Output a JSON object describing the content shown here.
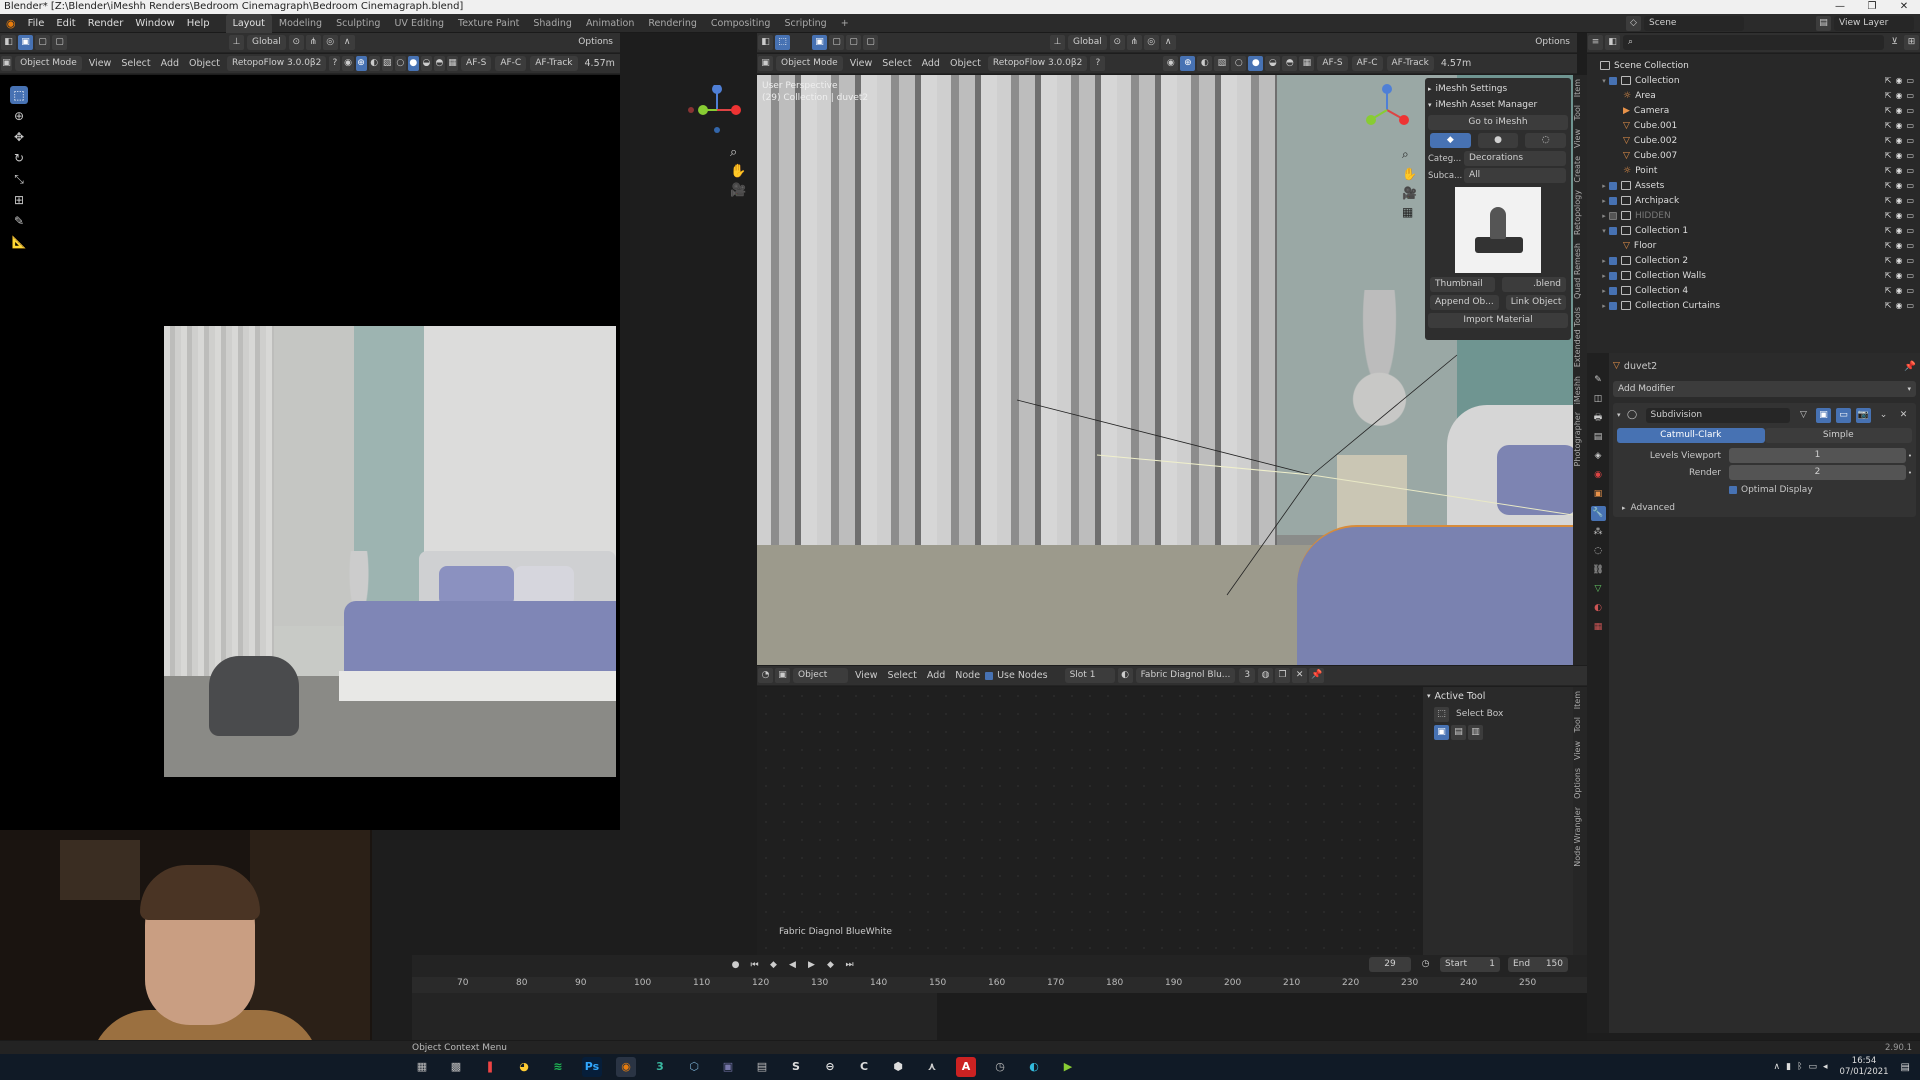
{
  "window": {
    "title": "Blender* [Z:\\Blender\\iMeshh Renders\\Bedroom Cinemagraph\\Bedroom Cinemagraph.blend]",
    "min": "—",
    "max": "❐",
    "close": "✕"
  },
  "menu": [
    "File",
    "Edit",
    "Render",
    "Window",
    "Help"
  ],
  "workspaces": [
    {
      "label": "Layout",
      "active": true
    },
    {
      "label": "Modeling"
    },
    {
      "label": "Sculpting"
    },
    {
      "label": "UV Editing"
    },
    {
      "label": "Texture Paint"
    },
    {
      "label": "Shading"
    },
    {
      "label": "Animation"
    },
    {
      "label": "Rendering"
    },
    {
      "label": "Compositing"
    },
    {
      "label": "Scripting"
    },
    {
      "label": "+"
    }
  ],
  "scene": {
    "label": "Scene",
    "view_layer": "View Layer"
  },
  "left_viewport": {
    "mode": "Object Mode",
    "menus": [
      "View",
      "Select",
      "Add",
      "Object"
    ],
    "addon": "RetopoFlow 3.0.0β2",
    "transform": "Global",
    "options": "Options",
    "af_s": "AF-S",
    "af_c": "AF-C",
    "af_track": "AF-Track",
    "dist": "4.57m"
  },
  "main_viewport": {
    "mode": "Object Mode",
    "menus": [
      "View",
      "Select",
      "Add",
      "Object"
    ],
    "addon": "RetopoFlow 3.0.0β2",
    "transform": "Global",
    "options": "Options",
    "af_s": "AF-S",
    "af_c": "AF-C",
    "af_track": "AF-Track",
    "dist": "4.57m",
    "overlay_title": "User Perspective",
    "overlay_sub": "(29) Collection | duvet2"
  },
  "imeshh": {
    "settings": "iMeshh Settings",
    "manager": "iMeshh Asset Manager",
    "goto": "Go to iMeshh",
    "category_label": "Categ...",
    "category": "Decorations",
    "subcat_label": "Subca...",
    "subcat": "All",
    "thumbnail": "Thumbnail",
    "blend": ".blend",
    "append": "Append Ob...",
    "link": "Link Object",
    "import": "Import Material"
  },
  "viewport_tabs": [
    "Item",
    "Tool",
    "View",
    "Create",
    "Retopology",
    "Quad Remesh",
    "Extended Tools",
    "iMeshh",
    "Photographer"
  ],
  "node_editor": {
    "type": "Object",
    "menus": [
      "View",
      "Select",
      "Add",
      "Node"
    ],
    "use_nodes": "Use Nodes",
    "slot": "Slot 1",
    "material": "Fabric Diagnol Blu...",
    "users": "3",
    "frame_label": "Fabric Diagnol BlueWhite",
    "active_tool": "Active Tool",
    "select_box": "Select Box",
    "tabs": [
      "Item",
      "Tool",
      "View",
      "Options",
      "Node Wrangler"
    ]
  },
  "outliner": {
    "title": "Scene Collection",
    "items": [
      {
        "label": "Collection",
        "depth": 0,
        "type": "coll",
        "open": true,
        "check": true
      },
      {
        "label": "Area",
        "depth": 1,
        "type": "obj",
        "icon": "☼"
      },
      {
        "label": "Camera",
        "depth": 1,
        "type": "obj",
        "icon": "▶"
      },
      {
        "label": "Cube.001",
        "depth": 1,
        "type": "obj",
        "icon": "▽"
      },
      {
        "label": "Cube.002",
        "depth": 1,
        "type": "obj",
        "icon": "▽"
      },
      {
        "label": "Cube.007",
        "depth": 1,
        "type": "obj",
        "icon": "▽"
      },
      {
        "label": "Point",
        "depth": 1,
        "type": "obj",
        "icon": "☼"
      },
      {
        "label": "Assets",
        "depth": 0,
        "type": "coll",
        "check": true
      },
      {
        "label": "Archipack",
        "depth": 0,
        "type": "coll",
        "check": true
      },
      {
        "label": "HIDDEN",
        "depth": 0,
        "type": "coll",
        "check": false,
        "dim": true
      },
      {
        "label": "Collection 1",
        "depth": 0,
        "type": "coll",
        "open": true,
        "check": true
      },
      {
        "label": "Floor",
        "depth": 1,
        "type": "obj",
        "icon": "▽"
      },
      {
        "label": "Collection 2",
        "depth": 0,
        "type": "coll",
        "check": true
      },
      {
        "label": "Collection Walls",
        "depth": 0,
        "type": "coll",
        "check": true
      },
      {
        "label": "Collection 4",
        "depth": 0,
        "type": "coll",
        "check": true
      },
      {
        "label": "Collection Curtains",
        "depth": 0,
        "type": "coll",
        "check": true
      }
    ]
  },
  "properties": {
    "object": "duvet2",
    "add_modifier": "Add Modifier",
    "modifier": "Subdivision",
    "catmull": "Catmull-Clark",
    "simple": "Simple",
    "levels_label": "Levels Viewport",
    "levels_value": "1",
    "render_label": "Render",
    "render_value": "2",
    "optimal": "Optimal Display",
    "advanced": "Advanced"
  },
  "timeline": {
    "current": "29",
    "start_label": "Start",
    "start": "1",
    "end_label": "End",
    "end": "150",
    "ticks": [
      "70",
      "80",
      "90",
      "100",
      "110",
      "120",
      "130",
      "140",
      "150",
      "160",
      "170",
      "180",
      "190",
      "200",
      "210",
      "220",
      "230",
      "240",
      "250"
    ]
  },
  "status": {
    "left": "Object Context Menu",
    "version": "2.90.1"
  },
  "taskbar": {
    "time": "16:54",
    "date": "07/01/2021"
  }
}
